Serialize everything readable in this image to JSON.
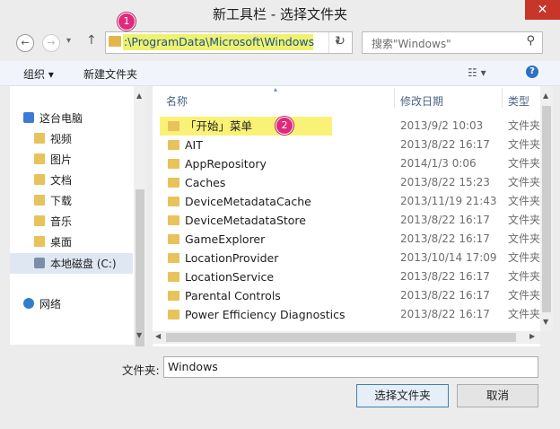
{
  "window": {
    "title": "新工具栏 - 选择文件夹",
    "close_glyph": "✕"
  },
  "nav": {
    "back": "←",
    "forward": "→",
    "dropdown": "▾",
    "up": "↑"
  },
  "address": {
    "value": ":\\ProgramData\\Microsoft\\Windows",
    "drop_glyph": "▾",
    "refresh_glyph": "↻"
  },
  "search": {
    "placeholder": "搜索\"Windows\"",
    "icon_glyph": "⚲"
  },
  "toolbar": {
    "organize": "组织 ▾",
    "new_folder": "新建文件夹",
    "view_glyph": "☷ ▾",
    "help_glyph": "?"
  },
  "sidebar": {
    "items": [
      {
        "label": "这台电脑"
      },
      {
        "label": "视频"
      },
      {
        "label": "图片"
      },
      {
        "label": "文档"
      },
      {
        "label": "下载"
      },
      {
        "label": "音乐"
      },
      {
        "label": "桌面"
      },
      {
        "label": "本地磁盘 (C:)"
      },
      {
        "label": "网络"
      }
    ]
  },
  "columns": {
    "name": "名称",
    "date": "修改日期",
    "type": "类型"
  },
  "files": [
    {
      "name": "「开始」菜单",
      "date": "2013/9/2 10:03",
      "type": "文件夹"
    },
    {
      "name": "AIT",
      "date": "2013/8/22 16:17",
      "type": "文件夹"
    },
    {
      "name": "AppRepository",
      "date": "2014/1/3 0:06",
      "type": "文件夹"
    },
    {
      "name": "Caches",
      "date": "2013/8/22 15:23",
      "type": "文件夹"
    },
    {
      "name": "DeviceMetadataCache",
      "date": "2013/11/19 21:43",
      "type": "文件夹"
    },
    {
      "name": "DeviceMetadataStore",
      "date": "2013/8/22 16:17",
      "type": "文件夹"
    },
    {
      "name": "GameExplorer",
      "date": "2013/8/22 16:17",
      "type": "文件夹"
    },
    {
      "name": "LocationProvider",
      "date": "2013/10/14 17:09",
      "type": "文件夹"
    },
    {
      "name": "LocationService",
      "date": "2013/8/22 16:17",
      "type": "文件夹"
    },
    {
      "name": "Parental Controls",
      "date": "2013/8/22 16:17",
      "type": "文件夹"
    },
    {
      "name": "Power Efficiency Diagnostics",
      "date": "2013/8/22 16:17",
      "type": "文件夹"
    }
  ],
  "annotations": {
    "badge1": "1",
    "badge2": "2"
  },
  "bottom": {
    "folder_label": "文件夹:",
    "folder_value": "Windows",
    "select_button": "选择文件夹",
    "cancel_button": "取消"
  },
  "colors": {
    "highlight": "#faf277",
    "badge": "#e0297b",
    "close": "#c8362a"
  }
}
